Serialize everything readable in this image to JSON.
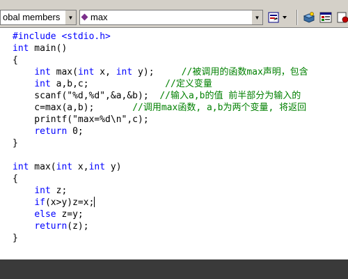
{
  "toolbar": {
    "scope_combo_value": "obal members",
    "member_combo_value": "max",
    "icons": [
      "wizard-dropdown-icon",
      "build-icon",
      "class-view-icon",
      "breakpoint-icon"
    ]
  },
  "code_lines": [
    [
      {
        "t": "#include <stdio.h>",
        "c": "kw"
      }
    ],
    [
      {
        "t": "int",
        "c": "kw"
      },
      {
        "t": " main()"
      }
    ],
    [
      {
        "t": "{"
      }
    ],
    [
      {
        "t": "    "
      },
      {
        "t": "int",
        "c": "kw"
      },
      {
        "t": " max("
      },
      {
        "t": "int",
        "c": "kw"
      },
      {
        "t": " x, "
      },
      {
        "t": "int",
        "c": "kw"
      },
      {
        "t": " y);     "
      },
      {
        "t": "//被调用的函数max声明，包含",
        "c": "cm"
      }
    ],
    [
      {
        "t": "    "
      },
      {
        "t": "int",
        "c": "kw"
      },
      {
        "t": " a,b,c;              "
      },
      {
        "t": "//定义变量",
        "c": "cm"
      }
    ],
    [
      {
        "t": "    scanf(\"%d,%d\",&a,&b);  "
      },
      {
        "t": "//输入a,b的值 前半部分为输入的",
        "c": "cm"
      }
    ],
    [
      {
        "t": "    c=max(a,b);       "
      },
      {
        "t": "//调用max函数, a,b为两个变量, 将返回",
        "c": "cm"
      }
    ],
    [
      {
        "t": "    printf(\"max=%d\\n\",c);"
      }
    ],
    [
      {
        "t": "    "
      },
      {
        "t": "return",
        "c": "kw"
      },
      {
        "t": " 0;"
      }
    ],
    [
      {
        "t": "}"
      }
    ],
    [
      {
        "t": ""
      }
    ],
    [
      {
        "t": "int",
        "c": "kw"
      },
      {
        "t": " max("
      },
      {
        "t": "int",
        "c": "kw"
      },
      {
        "t": " x,"
      },
      {
        "t": "int",
        "c": "kw"
      },
      {
        "t": " y)"
      }
    ],
    [
      {
        "t": "{"
      }
    ],
    [
      {
        "t": "    "
      },
      {
        "t": "int",
        "c": "kw"
      },
      {
        "t": " z;"
      }
    ],
    [
      {
        "t": "    "
      },
      {
        "t": "if",
        "c": "kw"
      },
      {
        "t": "(x>y)z=x;"
      },
      {
        "t": "",
        "c": "caret"
      }
    ],
    [
      {
        "t": "    "
      },
      {
        "t": "else",
        "c": "kw"
      },
      {
        "t": " z=y;"
      }
    ],
    [
      {
        "t": "    "
      },
      {
        "t": "return",
        "c": "kw"
      },
      {
        "t": "(z);"
      }
    ],
    [
      {
        "t": "}"
      }
    ]
  ],
  "colors": {
    "keyword": "#0000ff",
    "comment": "#008000",
    "toolbar_bg": "#d4d0c8",
    "bottom_bg": "#3a3a3a"
  }
}
